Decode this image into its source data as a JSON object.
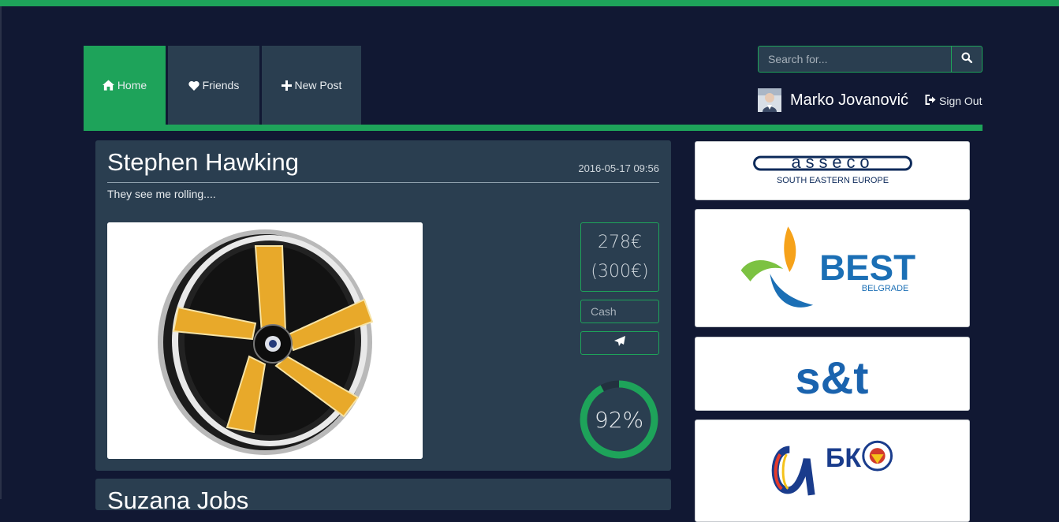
{
  "nav": {
    "tabs": [
      {
        "label": "Home",
        "icon": "home-icon",
        "active": true
      },
      {
        "label": "Friends",
        "icon": "heart-icon",
        "active": false
      },
      {
        "label": "New Post",
        "icon": "plus-icon",
        "active": false
      }
    ]
  },
  "search": {
    "placeholder": "Search for..."
  },
  "user": {
    "name": "Marko Jovanović",
    "signout_label": "Sign Out"
  },
  "posts": [
    {
      "author": "Stephen Hawking",
      "date": "2016-05-17 09:56",
      "text": "They see me rolling....",
      "price": "278€",
      "original_price": "(300€)",
      "cash_placeholder": "Cash",
      "progress_label": "92%",
      "progress": 0.92
    },
    {
      "author": "Suzana Jobs"
    }
  ],
  "ads": {
    "asseco": {
      "logo_text": "asseco",
      "subtitle": "SOUTH EASTERN EUROPE"
    },
    "best": {
      "logo_text": "BEST",
      "subtitle": "BELGRADE"
    },
    "snt": {
      "logo_text": "s&t"
    },
    "bk": {
      "logo_text": "БК"
    }
  },
  "colors": {
    "accent": "#1ea35a",
    "background": "#111833",
    "panel": "#2a3e50"
  }
}
